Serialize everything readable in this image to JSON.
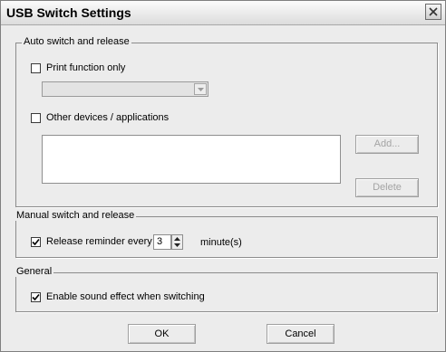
{
  "window": {
    "title": "USB Switch Settings"
  },
  "auto": {
    "group_label": "Auto switch and release",
    "print_only_label": "Print function only",
    "print_only_checked": false,
    "printer_select_value": "",
    "other_devices_label": "Other devices / applications",
    "other_devices_checked": false,
    "devices_list": [],
    "add_label": "Add...",
    "delete_label": "Delete"
  },
  "manual": {
    "group_label": "Manual switch and release",
    "reminder_label": "Release reminder every",
    "reminder_checked": true,
    "reminder_value": "3",
    "unit_label": "minute(s)"
  },
  "general": {
    "group_label": "General",
    "sound_label": "Enable sound effect when switching",
    "sound_checked": true
  },
  "footer": {
    "ok_label": "OK",
    "cancel_label": "Cancel"
  }
}
